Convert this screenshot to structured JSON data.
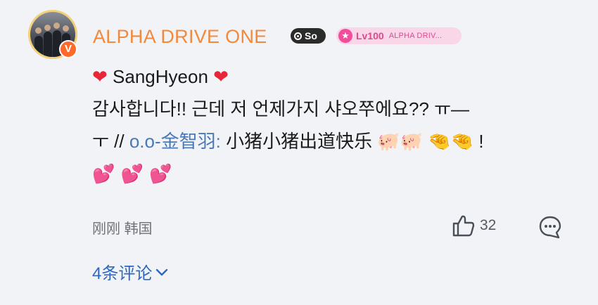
{
  "user": {
    "name": "ALPHA DRIVE ONE",
    "verified_mark": "V",
    "badges": {
      "so_label": "So",
      "level_label": "Lv100",
      "level_group": "ALPHA DRIV..."
    }
  },
  "comment": {
    "line1_name": "SangHyeon",
    "line2_text": "감사합니다!! 근데 저 언제가지 샤오쭈에요?? ㅠ—",
    "line3_prefix": "ㅜ //",
    "line3_mention": "o.o-金智羽:",
    "line3_text": "小猪小猪出道快乐",
    "line3_suffix": "!"
  },
  "meta": {
    "time": "刚刚",
    "location": "韩国",
    "like_count": "32"
  },
  "replies": {
    "label": "4条评论"
  },
  "icons": [
    "avatar-photo",
    "verified-icon",
    "so-badge-icon",
    "level-star-icon",
    "heart-icon",
    "pig-icon",
    "pinching-hand-icon",
    "pink-hearts-icon",
    "thumbs-up-icon",
    "comment-bubble-icon",
    "chevron-down-icon"
  ],
  "colors": {
    "name": "#f08a3e",
    "mention": "#4a78b8",
    "replies": "#2f68c0",
    "level_badge_bg": "#fad7e8",
    "level_badge_text": "#e0478f",
    "verified": "#ff6a2b"
  }
}
